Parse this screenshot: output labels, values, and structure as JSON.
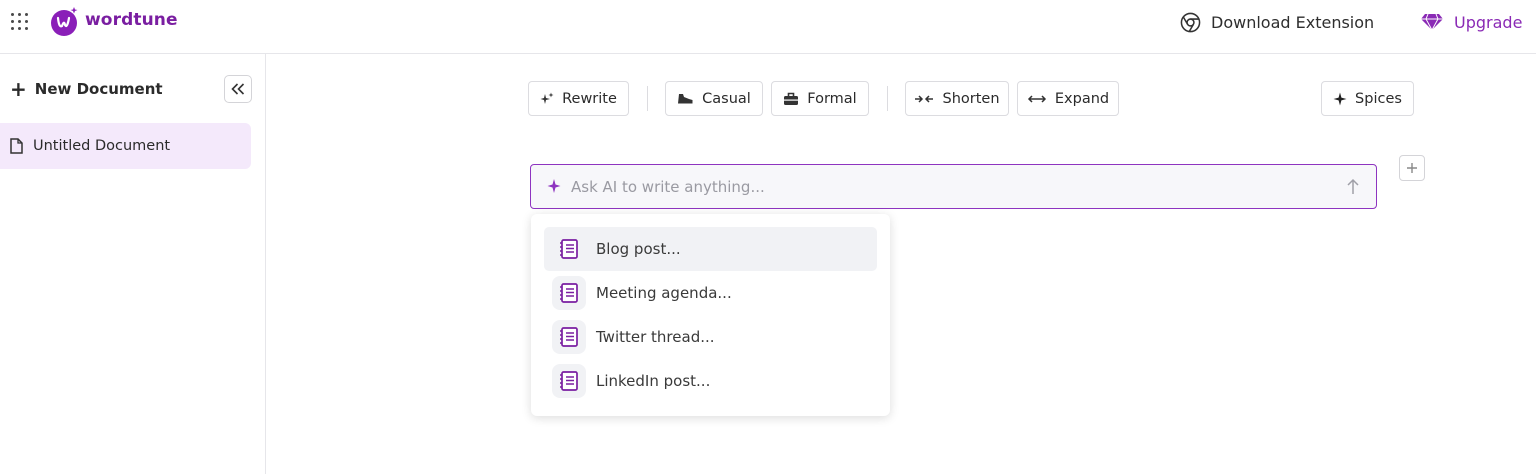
{
  "header": {
    "logo_text": "wordtune",
    "download_label": "Download Extension",
    "upgrade_label": "Upgrade"
  },
  "sidebar": {
    "new_document_label": "New Document",
    "documents": [
      {
        "title": "Untitled Document"
      }
    ]
  },
  "toolbar": {
    "rewrite": "Rewrite",
    "casual": "Casual",
    "formal": "Formal",
    "shorten": "Shorten",
    "expand": "Expand",
    "spices": "Spices"
  },
  "prompt": {
    "placeholder": "Ask AI to write anything..."
  },
  "suggestions": [
    {
      "label": "Blog post..."
    },
    {
      "label": "Meeting agenda..."
    },
    {
      "label": "Twitter thread..."
    },
    {
      "label": "LinkedIn post..."
    }
  ],
  "colors": {
    "brand": "#7a1ea1",
    "accent": "#8e34c0",
    "selected_doc_bg": "#f4e9fb"
  }
}
